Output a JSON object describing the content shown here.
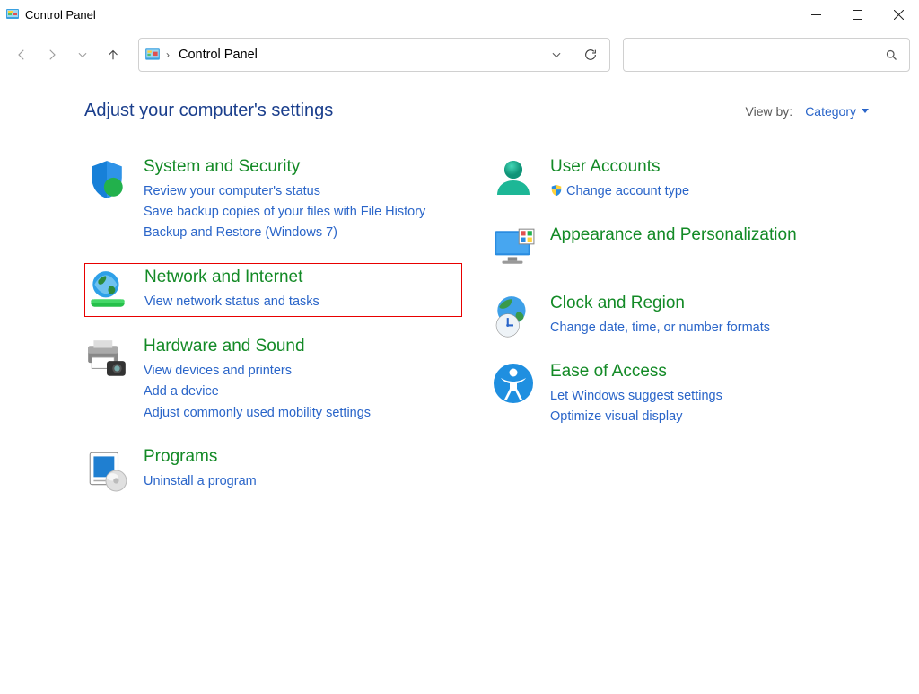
{
  "window": {
    "title": "Control Panel"
  },
  "breadcrumb": {
    "root": "Control Panel"
  },
  "heading": "Adjust your computer's settings",
  "viewby": {
    "label": "View by:",
    "value": "Category"
  },
  "categories": {
    "systemSecurity": {
      "title": "System and Security",
      "link1": "Review your computer's status",
      "link2": "Save backup copies of your files with File History",
      "link3": "Backup and Restore (Windows 7)"
    },
    "networkInternet": {
      "title": "Network and Internet",
      "link1": "View network status and tasks"
    },
    "hardwareSound": {
      "title": "Hardware and Sound",
      "link1": "View devices and printers",
      "link2": "Add a device",
      "link3": "Adjust commonly used mobility settings"
    },
    "programs": {
      "title": "Programs",
      "link1": "Uninstall a program"
    },
    "userAccounts": {
      "title": "User Accounts",
      "link1": "Change account type"
    },
    "appearance": {
      "title": "Appearance and Personalization"
    },
    "clockRegion": {
      "title": "Clock and Region",
      "link1": "Change date, time, or number formats"
    },
    "easeAccess": {
      "title": "Ease of Access",
      "link1": "Let Windows suggest settings",
      "link2": "Optimize visual display"
    }
  }
}
